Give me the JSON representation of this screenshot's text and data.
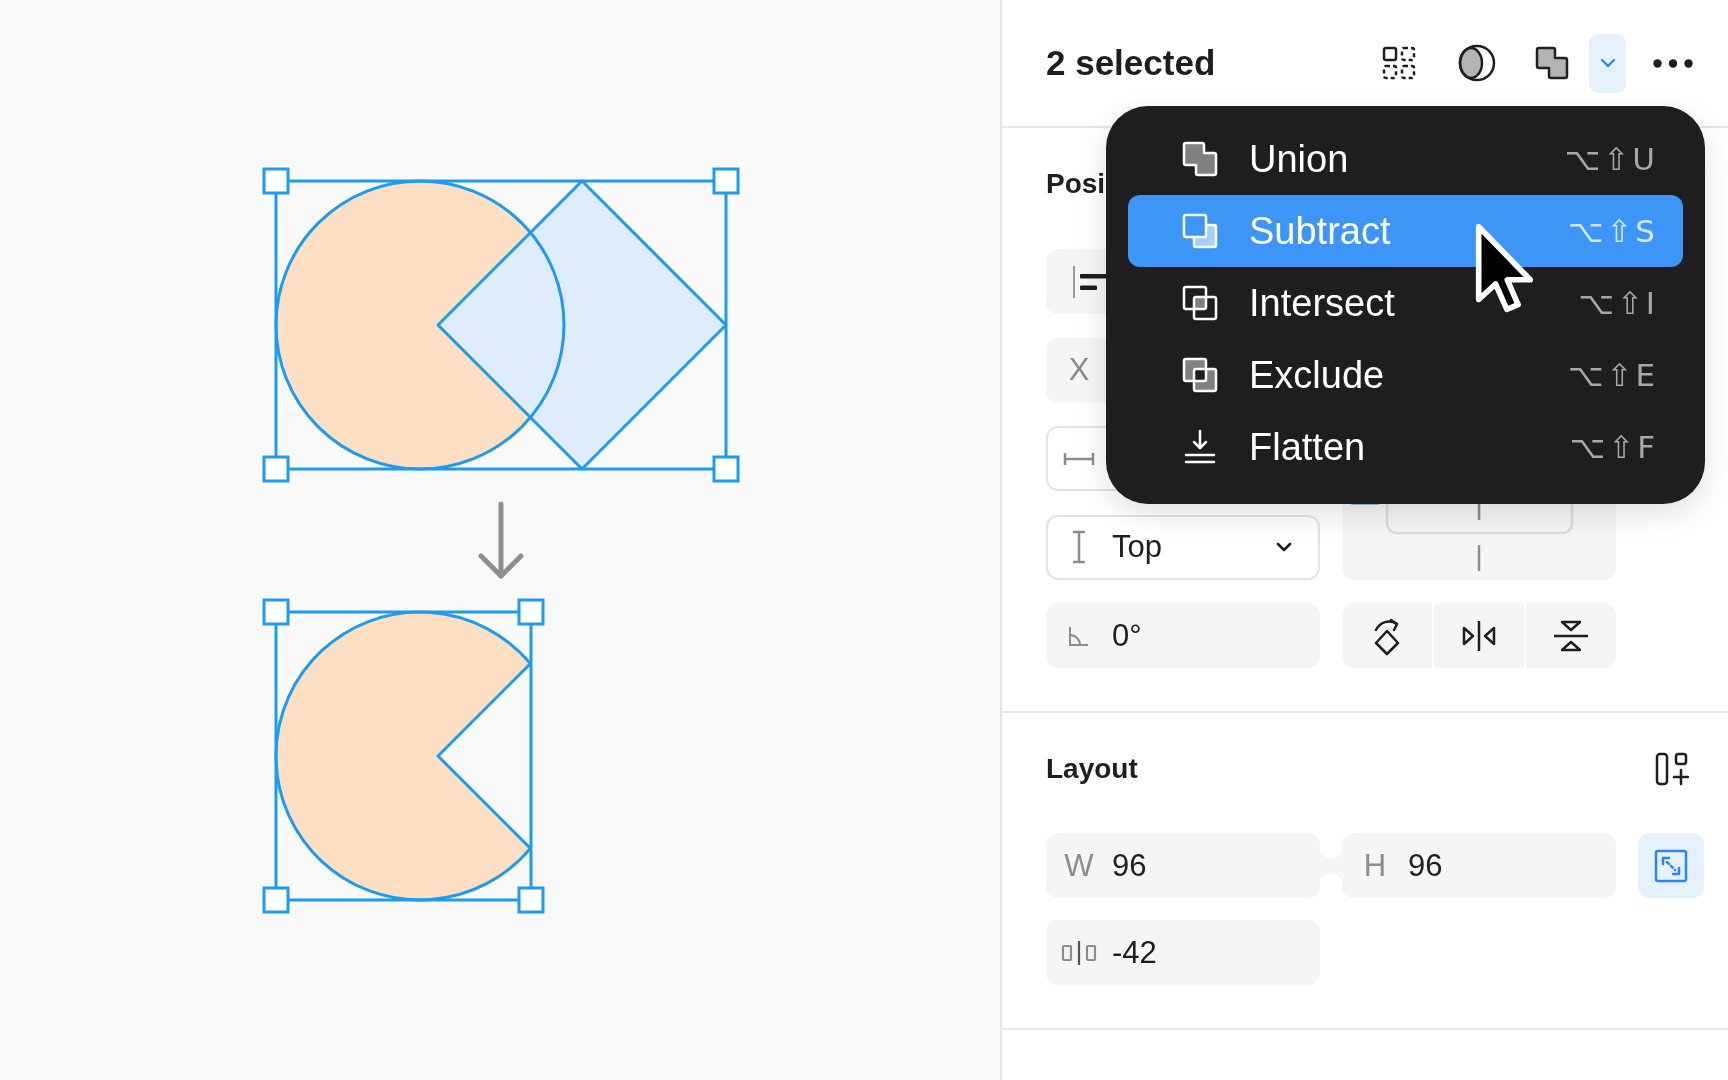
{
  "toolbar": {
    "title": "2 selected",
    "boolean_button": {
      "expanded": true
    }
  },
  "boolean_menu": {
    "items": [
      {
        "kind": "union",
        "label": "Union",
        "shortcut": "⌥⇧U",
        "selected": false
      },
      {
        "kind": "subtract",
        "label": "Subtract",
        "shortcut": "⌥⇧S",
        "selected": true
      },
      {
        "kind": "intersect",
        "label": "Intersect",
        "shortcut": "⌥⇧I",
        "selected": false
      },
      {
        "kind": "exclude",
        "label": "Exclude",
        "shortcut": "⌥⇧E",
        "selected": false
      },
      {
        "kind": "flatten",
        "label": "Flatten",
        "shortcut": "⌥⇧F",
        "selected": false
      }
    ]
  },
  "position": {
    "title": "Posi",
    "x_field": {
      "label": "X"
    },
    "vertical_constraint": {
      "value": "Top"
    },
    "rotation": {
      "value": "0°"
    }
  },
  "layout": {
    "title": "Layout",
    "width": {
      "label": "W",
      "value": "96"
    },
    "height": {
      "label": "H",
      "value": "96"
    },
    "resize_button": {
      "on": true
    },
    "gap": {
      "value": "-42"
    }
  }
}
